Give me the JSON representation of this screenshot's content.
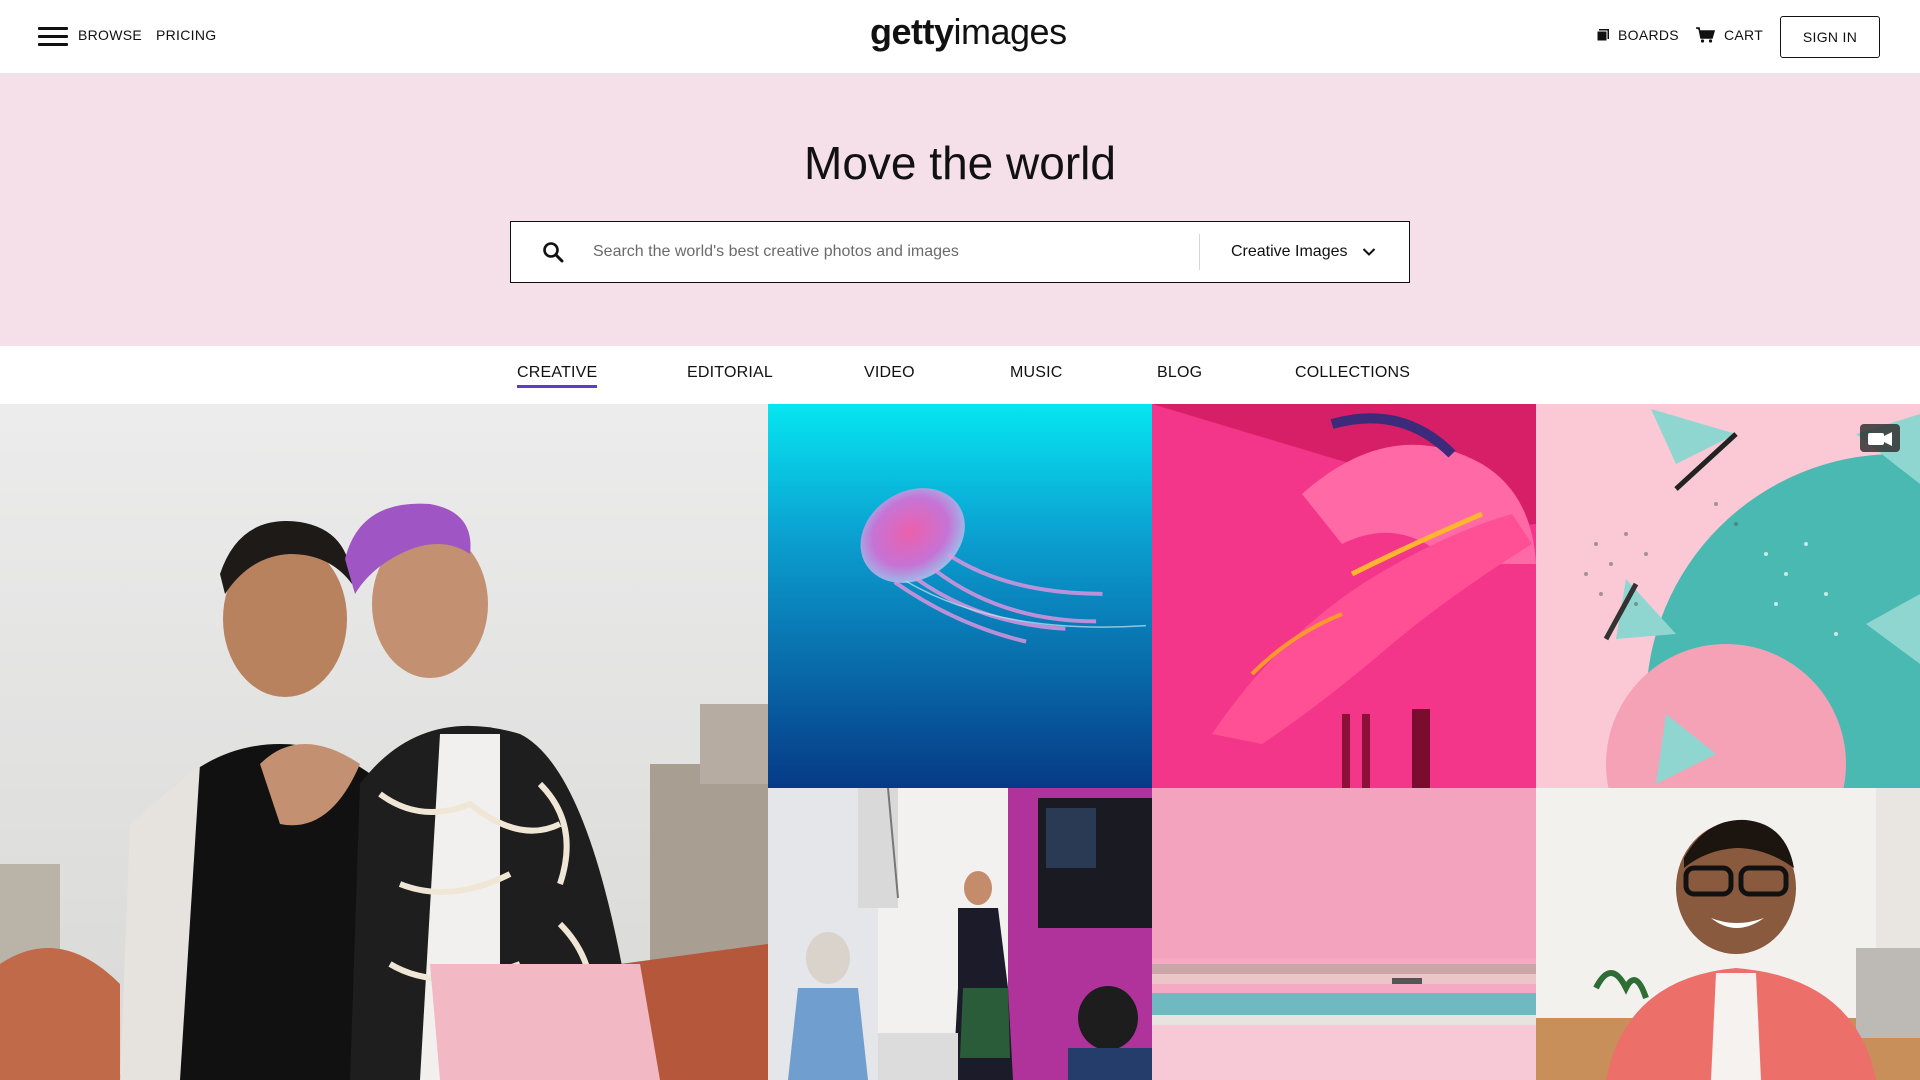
{
  "header": {
    "browse_label": "BROWSE",
    "pricing_label": "PRICING",
    "logo_bold": "getty",
    "logo_light": "images",
    "boards_label": "BOARDS",
    "cart_label": "CART",
    "signin_label": "SIGN IN"
  },
  "hero": {
    "title": "Move the world",
    "search_placeholder": "Search the world's best creative photos and images",
    "dropdown_label": "Creative Images",
    "background": "#f5dfe9"
  },
  "tabs": [
    {
      "label": "CREATIVE",
      "active": true
    },
    {
      "label": "EDITORIAL",
      "active": false
    },
    {
      "label": "VIDEO",
      "active": false
    },
    {
      "label": "MUSIC",
      "active": false
    },
    {
      "label": "BLOG",
      "active": false
    },
    {
      "label": "COLLECTIONS",
      "active": false
    }
  ],
  "colors": {
    "accent": "#5b3ec8",
    "text": "#111111"
  },
  "icons": [
    "menu-icon",
    "search-icon",
    "chevron-down-icon",
    "boards-icon",
    "cart-icon",
    "video-camera-icon"
  ]
}
